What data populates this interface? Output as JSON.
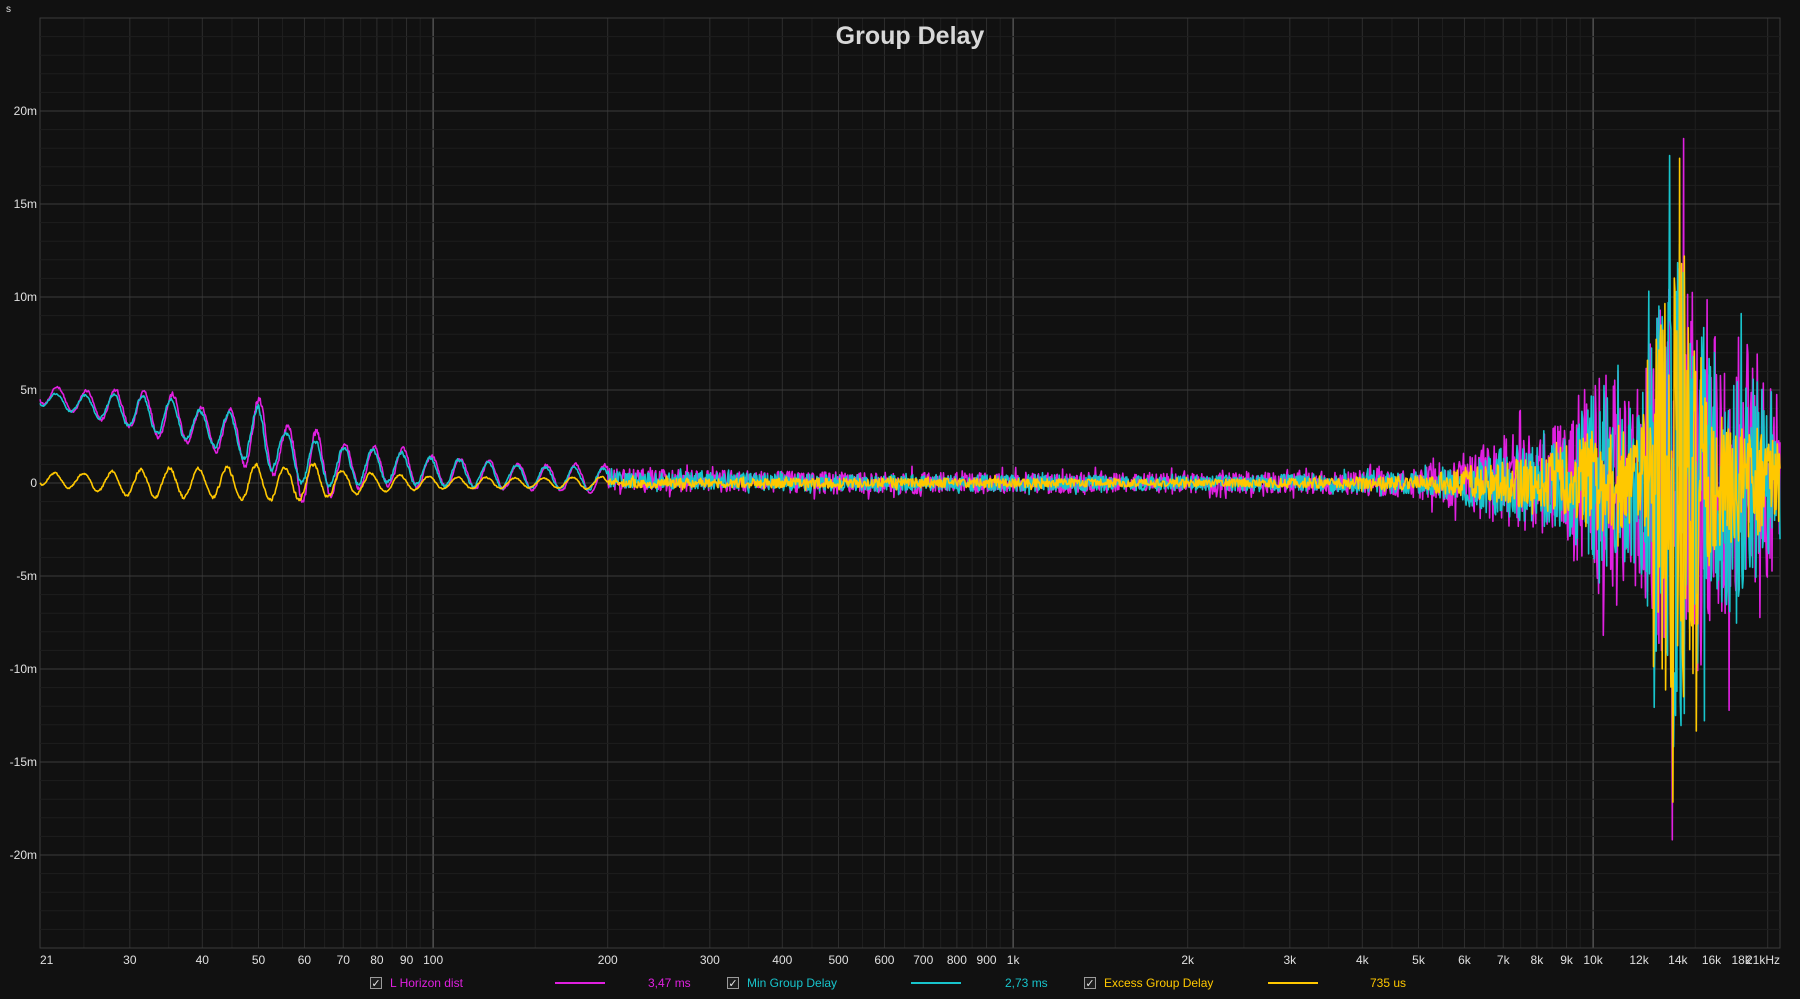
{
  "chart_data": {
    "type": "line",
    "title": "Group Delay",
    "y_unit": "s",
    "x_scale": "log",
    "xlim": [
      21,
      21000
    ],
    "ylim": [
      -0.025,
      0.025
    ],
    "grid": true,
    "x_ticks": [
      {
        "value": 21,
        "label": "21"
      },
      {
        "value": 30,
        "label": "30"
      },
      {
        "value": 40,
        "label": "40"
      },
      {
        "value": 50,
        "label": "50"
      },
      {
        "value": 60,
        "label": "60"
      },
      {
        "value": 70,
        "label": "70"
      },
      {
        "value": 80,
        "label": "80"
      },
      {
        "value": 90,
        "label": "90"
      },
      {
        "value": 100,
        "label": "100"
      },
      {
        "value": 200,
        "label": "200"
      },
      {
        "value": 300,
        "label": "300"
      },
      {
        "value": 400,
        "label": "400"
      },
      {
        "value": 500,
        "label": "500"
      },
      {
        "value": 600,
        "label": "600"
      },
      {
        "value": 700,
        "label": "700"
      },
      {
        "value": 800,
        "label": "800"
      },
      {
        "value": 900,
        "label": "900"
      },
      {
        "value": 1000,
        "label": "1k"
      },
      {
        "value": 2000,
        "label": "2k"
      },
      {
        "value": 3000,
        "label": "3k"
      },
      {
        "value": 4000,
        "label": "4k"
      },
      {
        "value": 5000,
        "label": "5k"
      },
      {
        "value": 6000,
        "label": "6k"
      },
      {
        "value": 7000,
        "label": "7k"
      },
      {
        "value": 8000,
        "label": "8k"
      },
      {
        "value": 9000,
        "label": "9k"
      },
      {
        "value": 10000,
        "label": "10k"
      },
      {
        "value": 12000,
        "label": "12k"
      },
      {
        "value": 14000,
        "label": "14k"
      },
      {
        "value": 16000,
        "label": "16k"
      },
      {
        "value": 18000,
        "label": "18k"
      },
      {
        "value": 21000,
        "label": "21kHz"
      }
    ],
    "y_ticks": [
      {
        "value": 0.02,
        "label": "20m"
      },
      {
        "value": 0.015,
        "label": "15m"
      },
      {
        "value": 0.01,
        "label": "10m"
      },
      {
        "value": 0.005,
        "label": "5m"
      },
      {
        "value": 0,
        "label": "0"
      },
      {
        "value": -0.005,
        "label": "-5m"
      },
      {
        "value": -0.01,
        "label": "-10m"
      },
      {
        "value": -0.015,
        "label": "-15m"
      },
      {
        "value": -0.02,
        "label": "-20m"
      }
    ],
    "series": [
      {
        "name": "L Horizon dist",
        "color": "#e020e0",
        "legend_value": "3,47 ms",
        "x": [
          21,
          25,
          30,
          35,
          40,
          45,
          50,
          55,
          60,
          70,
          80,
          90,
          100,
          150,
          200,
          300,
          500,
          1000,
          2000,
          3000,
          5000,
          6000,
          7000,
          8000,
          9000,
          10000,
          12000,
          14000,
          16000,
          18000,
          21000
        ],
        "y": [
          0.0048,
          0.0043,
          0.004,
          0.0036,
          0.003,
          0.0027,
          0.0025,
          0.0018,
          0.001,
          0.0008,
          0.0009,
          0.0008,
          0.0006,
          0.0003,
          0.0002,
          0.0001,
          0,
          0,
          0,
          0,
          0,
          0,
          0,
          0,
          0,
          0,
          0,
          0,
          0,
          0,
          0
        ],
        "env": [
          0.0006,
          0.0008,
          0.0012,
          0.0015,
          0.0012,
          0.0015,
          0.0025,
          0.0015,
          0.0025,
          0.0015,
          0.0012,
          0.0012,
          0.001,
          0.0008,
          0.0009,
          0.0009,
          0.0009,
          0.0009,
          0.0008,
          0.0009,
          0.0012,
          0.0025,
          0.004,
          0.0045,
          0.0055,
          0.0095,
          0.0085,
          0.021,
          0.013,
          0.012,
          0.009
        ]
      },
      {
        "name": "Min Group Delay",
        "color": "#18c4cc",
        "legend_value": "2,73 ms",
        "x": [
          21,
          25,
          30,
          35,
          40,
          45,
          50,
          55,
          60,
          70,
          80,
          90,
          100,
          150,
          200,
          300,
          500,
          1000,
          2000,
          3000,
          5000,
          6000,
          7000,
          8000,
          9000,
          10000,
          12000,
          14000,
          16000,
          18000,
          21000
        ],
        "y": [
          0.0045,
          0.0042,
          0.0039,
          0.0035,
          0.003,
          0.0027,
          0.0025,
          0.0018,
          0.0011,
          0.0009,
          0.0009,
          0.0008,
          0.0006,
          0.0003,
          0.0002,
          0.0001,
          0,
          0,
          0,
          0,
          0,
          0,
          0,
          0,
          0,
          0,
          0,
          0,
          0,
          0,
          0
        ],
        "env": [
          0.0004,
          0.0006,
          0.001,
          0.0012,
          0.001,
          0.0012,
          0.002,
          0.0012,
          0.0015,
          0.0012,
          0.001,
          0.001,
          0.0009,
          0.0007,
          0.0007,
          0.0007,
          0.0007,
          0.0007,
          0.0006,
          0.0007,
          0.0009,
          0.0018,
          0.003,
          0.0035,
          0.004,
          0.0075,
          0.0065,
          0.024,
          0.011,
          0.0095,
          0.007
        ]
      },
      {
        "name": "Excess Group Delay",
        "color": "#ffc800",
        "legend_value": "735 us",
        "x": [
          21,
          25,
          30,
          35,
          40,
          45,
          50,
          55,
          60,
          70,
          80,
          90,
          100,
          150,
          200,
          300,
          500,
          1000,
          2000,
          3000,
          5000,
          6000,
          7000,
          8000,
          9000,
          10000,
          12000,
          14000,
          16000,
          18000,
          21000
        ],
        "y": [
          0.0002,
          0.0001,
          0,
          0,
          0,
          0,
          0,
          0,
          0.0001,
          0,
          0,
          0,
          0,
          0,
          0,
          0,
          0,
          0,
          0,
          0,
          0,
          0,
          0,
          0,
          0,
          0,
          0,
          0,
          0,
          0,
          0
        ],
        "env": [
          0.0004,
          0.0005,
          0.0008,
          0.001,
          0.0009,
          0.001,
          0.0012,
          0.001,
          0.0012,
          0.0008,
          0.0006,
          0.0005,
          0.0004,
          0.0003,
          0.0004,
          0.0004,
          0.0004,
          0.0004,
          0.0003,
          0.0004,
          0.0006,
          0.0012,
          0.0018,
          0.0022,
          0.0026,
          0.0045,
          0.0035,
          0.024,
          0.006,
          0.005,
          0.004
        ]
      }
    ]
  }
}
